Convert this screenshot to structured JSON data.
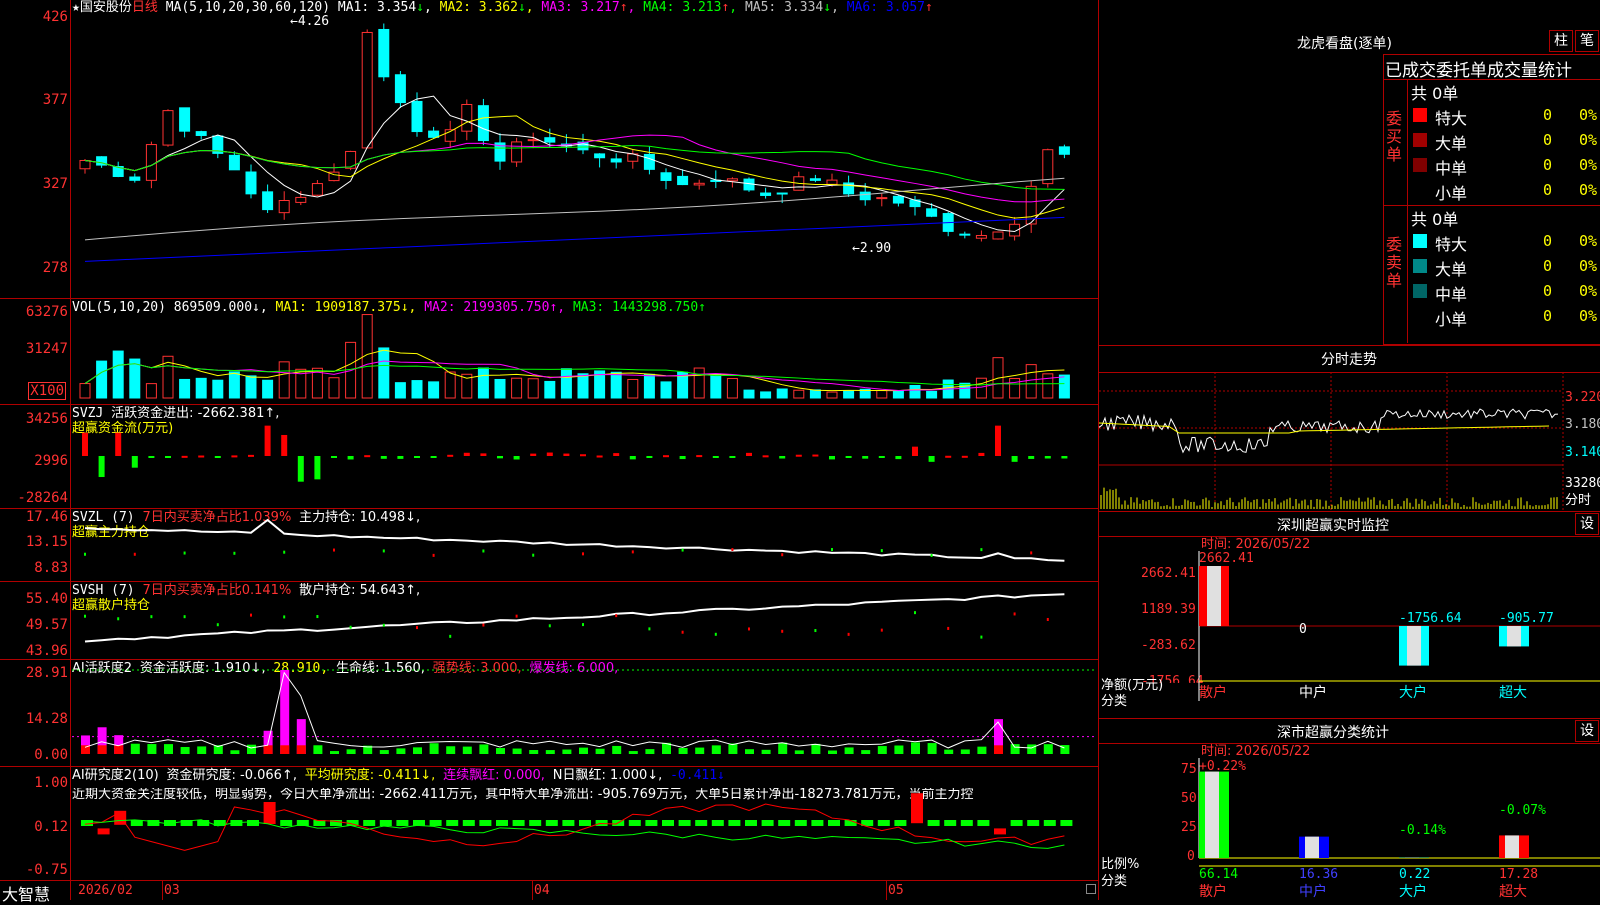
{
  "stock": {
    "name": "国安股份",
    "period": "日线",
    "ma_title": "MA(5,10,20,30,60,120)",
    "ma": [
      {
        "label": "MA1: 3.354",
        "arrow": "↓",
        "color": "#ffffff"
      },
      {
        "label": "MA2: 3.362",
        "arrow": "↓",
        "color": "#ffff00"
      },
      {
        "label": "MA3: 3.217",
        "arrow": "↑",
        "color": "#ff00ff"
      },
      {
        "label": "MA4: 3.213",
        "arrow": "↑",
        "color": "#00ff00"
      },
      {
        "label": "MA5: 3.334",
        "arrow": "↓",
        "color": "#c0c0c0"
      },
      {
        "label": "MA6: 3.057",
        "arrow": "↑",
        "color": "#0000ff"
      }
    ],
    "high_mark": "4.26",
    "low_mark": "2.90",
    "price_axis": [
      "426",
      "377",
      "327",
      "278"
    ]
  },
  "vol": {
    "title": "VOL(5,10,20)",
    "value": "869509.000↓,",
    "ma1": "MA1: 1909187.375↓,",
    "ma2": "MA2: 2199305.750↑,",
    "ma3": "MA3: 1443298.750↑",
    "axis": [
      "63276",
      "31247"
    ],
    "unit": "X100"
  },
  "svzj": {
    "title": "SVZJ",
    "text": "活跃资金进出: -2662.381↑,",
    "subtitle": "超赢资金流(万元)",
    "axis": [
      "34256",
      "2996",
      "-28264"
    ]
  },
  "svzl": {
    "title": "SVZL (7)",
    "text1": "7日内买卖净占比1.039%",
    "text2": "主力持仓: 10.498↓,",
    "subtitle": "超赢主力持仓",
    "axis": [
      "17.46",
      "13.15",
      "8.83"
    ]
  },
  "svsh": {
    "title": "SVSH (7)",
    "text1": "7日内买卖净占比0.141%",
    "text2": "散户持仓: 54.643↑,",
    "subtitle": "超赢散户持仓",
    "axis": [
      "55.40",
      "49.57",
      "43.96"
    ]
  },
  "ai1": {
    "title": "AI活跃度2",
    "text1": "资金活跃度: 1.910↓,",
    "text2": "28.910,",
    "text3": "生命线: 1.560,",
    "text4": "强势线: 3.000,",
    "text5": "爆发线: 6.000,",
    "axis": [
      "28.91",
      "14.28",
      "0.00"
    ]
  },
  "ai2": {
    "title": "AI研究度2(10)",
    "text1": "资金研究度: -0.066↑,",
    "text2": "平均研究度: -0.411↓,",
    "text3": "连续飘红: 0.000,",
    "text4": "N日飘红: 1.000↓,",
    "text5": "-0.411↓",
    "note": "近期大资金关注度较低，明显弱势，今日大单净流出: -2662.411万元，其中特大单净流出: -905.769万元，大单5日累计净出-18273.781万元，当前主力控",
    "axis": [
      "1.00",
      "0.12",
      "-0.75"
    ]
  },
  "bottom_bar": {
    "brand": "大智慧",
    "dates": [
      "2026/02",
      "03",
      "04",
      "05"
    ]
  },
  "longhu": {
    "title": "龙虎看盘(逐单)",
    "btn1": "柱",
    "btn2": "笔",
    "header": "已成交委托单成交量统计",
    "buy_label": "委买单",
    "sell_label": "委卖单",
    "buy_total": "共 0单",
    "sell_total": "共 0单",
    "rows_buy": [
      {
        "name": "特大",
        "val": "0",
        "pct": "0%",
        "color": "#ff0000"
      },
      {
        "name": "大单",
        "val": "0",
        "pct": "0%",
        "color": "#a00000"
      },
      {
        "name": "中单",
        "val": "0",
        "pct": "0%",
        "color": "#800000"
      },
      {
        "name": "小单",
        "val": "0",
        "pct": "0%",
        "color": "#000000"
      }
    ],
    "rows_sell": [
      {
        "name": "特大",
        "val": "0",
        "pct": "0%",
        "color": "#00ffff"
      },
      {
        "name": "大单",
        "val": "0",
        "pct": "0%",
        "color": "#008888"
      },
      {
        "name": "中单",
        "val": "0",
        "pct": "0%",
        "color": "#006666"
      },
      {
        "name": "小单",
        "val": "0",
        "pct": "0%",
        "color": "#000000"
      }
    ]
  },
  "fenshi": {
    "title": "分时走势",
    "axis": [
      "3.220",
      "3.180",
      "3.140",
      "33280"
    ],
    "label": "分时"
  },
  "monitor": {
    "title": "深圳超赢实时监控",
    "btn": "设",
    "time": "时间: 2026/05/22",
    "axis": [
      "2662.41",
      "1189.39",
      "-283.62",
      "-1756.64"
    ],
    "axis_title": "净额(万元)",
    "cat_label": "分类",
    "bar_labels": [
      "2662.41",
      "0",
      "-1756.64",
      "-905.77"
    ],
    "categories": [
      "散户",
      "中户",
      "大户",
      "超大"
    ]
  },
  "classify": {
    "title": "深市超赢分类统计",
    "btn": "设",
    "time": "时间: 2026/05/22",
    "axis": [
      "75",
      "50",
      "25",
      "0"
    ],
    "axis_title": "比例%",
    "cat_label": "分类",
    "top_labels": [
      "+0.22%",
      "-0.14%",
      "-0.07%"
    ],
    "bottom_values": [
      "66.14",
      "16.36",
      "0.22",
      "17.28"
    ],
    "categories": [
      "散户",
      "中户",
      "大户",
      "超大"
    ]
  }
}
